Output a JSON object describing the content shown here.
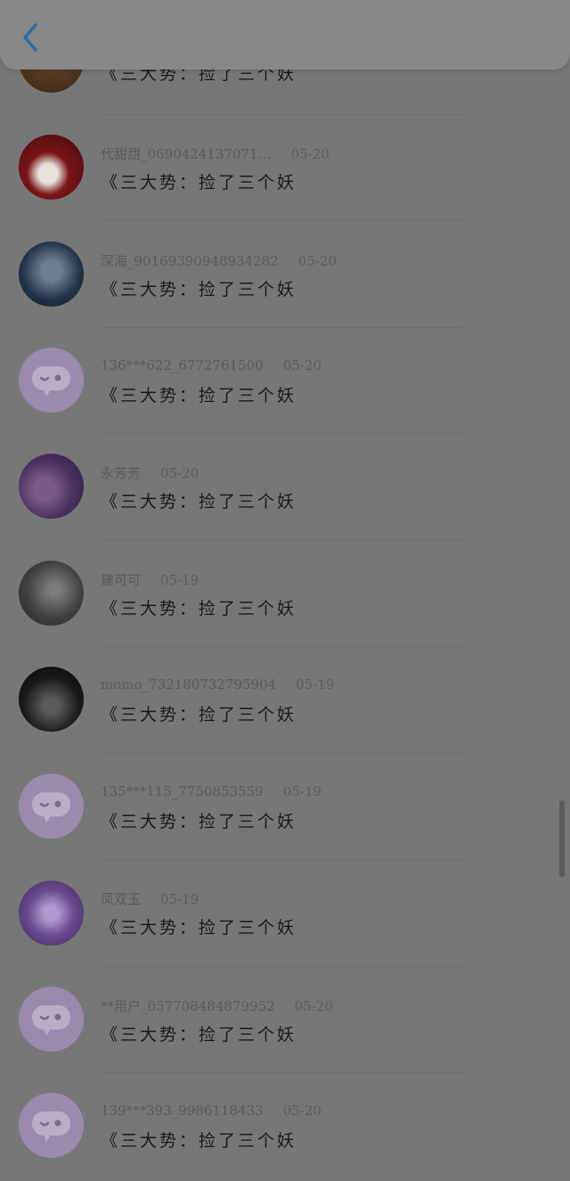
{
  "header": {
    "back_icon": "chevron-left-icon",
    "accent": "#2a6fa6"
  },
  "comments": [
    {
      "user": "",
      "date": "",
      "text": "《三大势：捡了三个妖",
      "avatar": "photo"
    },
    {
      "user": "代甜甜_0690424137071…",
      "date": "05-20",
      "text": "《三大势：捡了三个妖",
      "avatar": "photo"
    },
    {
      "user": "深海_90169390948934282",
      "date": "05-20",
      "text": "《三大势：捡了三个妖",
      "avatar": "photo"
    },
    {
      "user": "136***622_6772761500",
      "date": "05-20",
      "text": "《三大势：捡了三个妖",
      "avatar": "default"
    },
    {
      "user": "永芳芳",
      "date": "05-20",
      "text": "《三大势：捡了三个妖",
      "avatar": "photo"
    },
    {
      "user": "建可可",
      "date": "05-19",
      "text": "《三大势：捡了三个妖",
      "avatar": "photo"
    },
    {
      "user": "momo_732180732795904",
      "date": "05-19",
      "text": "《三大势：捡了三个妖",
      "avatar": "photo"
    },
    {
      "user": "135***115_7750853559",
      "date": "05-19",
      "text": "《三大势：捡了三个妖",
      "avatar": "default"
    },
    {
      "user": "凤双玉",
      "date": "05-19",
      "text": "《三大势：捡了三个妖",
      "avatar": "photo"
    },
    {
      "user": "**用户_057708484879952",
      "date": "05-20",
      "text": "《三大势：捡了三个妖",
      "avatar": "default"
    },
    {
      "user": "139***393_9986118433",
      "date": "05-20",
      "text": "《三大势：捡了三个妖",
      "avatar": "default"
    }
  ],
  "colors": {
    "overlay": "#777777",
    "default_avatar": "#9b8aad",
    "divider": "#6e6e6e"
  }
}
